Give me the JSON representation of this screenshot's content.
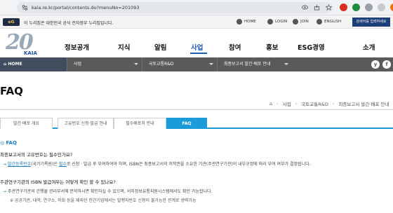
{
  "browser": {
    "url": "kaia.re.kr/portal/contents.do?menuNo=201093"
  },
  "gov_banner": {
    "logo_text": "eG",
    "text": "이 누리집은 대한민국 공식 전자정부 누리집입니다.",
    "links": [
      "HOME",
      "LOGIN",
      "JOIN",
      "ENGLISH"
    ],
    "search_button": "검색어를 입력하세요"
  },
  "logo": {
    "number": "20",
    "name": "KAIA"
  },
  "main_nav": {
    "items": [
      "정보공개",
      "지식",
      "알림",
      "사업",
      "참여",
      "홍보",
      "ESG경영",
      "소개"
    ],
    "active": "사업"
  },
  "sub_nav": {
    "home": "HOME",
    "segments": [
      "사업",
      "국토교통R&D",
      "최종보고서 발간·배포 안내"
    ],
    "social": [
      "y",
      "f"
    ]
  },
  "page": {
    "title": "FAQ",
    "breadcrumb": [
      "사업",
      "국토교통R&D",
      "최종보고서 발간·배포 안내"
    ]
  },
  "tabs": {
    "items": [
      "발간·배포 개요",
      "고유번호 신청·발급 안내",
      "필수배포처 안내",
      "FAQ"
    ],
    "active": "FAQ"
  },
  "faq": {
    "heading": "FAQ",
    "items": [
      {
        "question": "최종보고서의 고유번호는 필수인가요?",
        "answer_prefix": "→",
        "answer_link": "발간등록번호",
        "answer_mid": "(국가기록원)은",
        "answer_emph": "필수",
        "answer_rest": "로 신청 · 발급 후 부여하여야 하며, ISBN은 최종보고서의 저작권을 소유한 기관(주관연구기관)의 내부규정에 따라 부여 여부가 결정됩니다."
      },
      {
        "question": "주관연구기관의 ISBN 발급여부는 어떻게 확인 할 수 있나요?",
        "answer_prefix": "→",
        "answer_rest": "주관연구기관의 간행물 관리부서에 문의하시면 확인하실 수 있으며, 서지정보유통지원시스템에서도 확인 가능합니다.",
        "note": "※ 공공기관, 대학, 연구소, 학회 등을 제외한 민간기업에서는 발행자번호 신청이 불가능한 관계로 생략가능"
      }
    ]
  }
}
